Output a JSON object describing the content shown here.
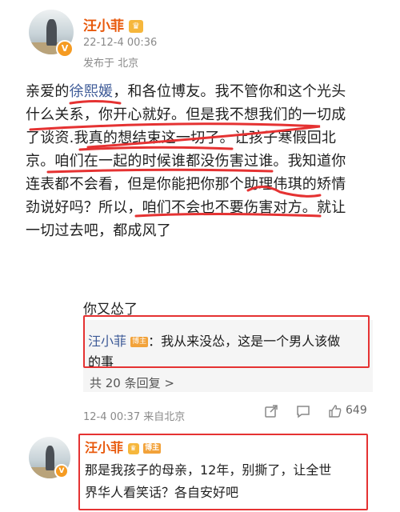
{
  "post": {
    "author": "汪小菲",
    "time": "22-12-4 00:36",
    "location": "发布于 北京",
    "text_lines": [
      [
        "亲爱的",
        "徐熙媛",
        "，和各位博友。我不管你和这个光头"
      ],
      [
        "什么关系，你开心就好。但是我不想我们的一切成"
      ],
      [
        "了谈资.我真的想结束这一切了。让孩子寒假回北"
      ],
      [
        "京。咱们在一起的时候谁都没伤害过谁。我知道你"
      ],
      [
        "连表都不会看，但是你能把你那个助理伟琪的矫情"
      ],
      [
        "劲说好吗？所以，咱们不会也不要伤害对方。就让"
      ],
      [
        "一切过去吧，都成风了"
      ]
    ]
  },
  "comment": {
    "text": "你又怂了",
    "sub_reply": {
      "author": "汪小菲",
      "tag": "博主",
      "text_line1": "：我从来没怂，这是一个男人该做",
      "text_line2": "的事"
    },
    "more_replies": "共 20 条回复 >",
    "time": "12-4 00:37 来自北京",
    "like_count": "649"
  },
  "reply": {
    "author": "汪小菲",
    "tag": "博主",
    "text_line1": "那是我孩子的母亲，12年，别撕了，让全世",
    "text_line2": "界华人看笑话？各自安好吧"
  },
  "colors": {
    "username": "#e8590c",
    "link": "#3d5a97",
    "annotation_red": "#e53232",
    "badge_orange": "#f59b22"
  },
  "icons": {
    "verify": "orange-v-badge-icon",
    "crown": "crown-badge-icon",
    "share": "share-icon",
    "comment": "comment-icon",
    "like": "thumb-up-icon"
  }
}
